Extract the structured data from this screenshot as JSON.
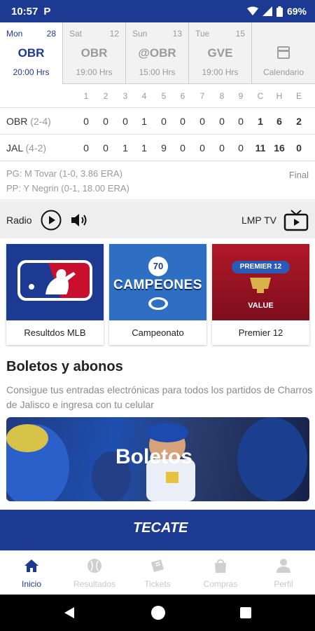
{
  "status_bar": {
    "time": "10:57",
    "app_icon": "P",
    "battery": "69%"
  },
  "games": [
    {
      "day": "Mon",
      "date": "28",
      "team": "OBR",
      "time": "20:00 Hrs",
      "active": true
    },
    {
      "day": "Sat",
      "date": "12",
      "team": "OBR",
      "time": "19:00 Hrs",
      "active": false
    },
    {
      "day": "Sun",
      "date": "13",
      "team": "@OBR",
      "time": "15:00 Hrs",
      "active": false
    },
    {
      "day": "Tue",
      "date": "15",
      "team": "GVE",
      "time": "19:00 Hrs",
      "active": false
    }
  ],
  "calendar_label": "Calendario",
  "linescore": {
    "headers": [
      "1",
      "2",
      "3",
      "4",
      "5",
      "6",
      "7",
      "8",
      "9",
      "C",
      "H",
      "E"
    ],
    "teams": [
      {
        "abbr": "OBR",
        "record": "(2-4)",
        "innings": [
          "0",
          "0",
          "0",
          "1",
          "0",
          "0",
          "0",
          "0",
          "0"
        ],
        "totals": [
          "1",
          "6",
          "2"
        ]
      },
      {
        "abbr": "JAL",
        "record": "(4-2)",
        "innings": [
          "0",
          "0",
          "1",
          "1",
          "9",
          "0",
          "0",
          "0",
          "0"
        ],
        "totals": [
          "11",
          "16",
          "0"
        ]
      }
    ]
  },
  "pitchers": {
    "winning": "PG: M Tovar (1-0, 3.86 ERA)",
    "losing": "PP: Y Negrin (0-1, 18.00 ERA)",
    "status": "Final"
  },
  "radio": {
    "radio_label": "Radio",
    "tv_label": "LMP TV"
  },
  "promos": [
    {
      "label": "Resultdos MLB"
    },
    {
      "label": "Campeonato",
      "badge_number": "70",
      "badge_text": "CAMPEONES"
    },
    {
      "label": "Premier 12",
      "badge_text": "PREMIER 12",
      "sub_text": "VALUE"
    }
  ],
  "boletos": {
    "title": "Boletos y abonos",
    "description": "Consigue tus entradas electrónicas para todos los partidos de Charros de Jalisco e ingresa con tu celular",
    "banner_text": "Boletos"
  },
  "sponsor": {
    "name": "TECATE"
  },
  "bottom_nav": [
    {
      "label": "Inicio",
      "icon": "home-icon",
      "active": true
    },
    {
      "label": "Resultados",
      "icon": "baseball-icon",
      "active": false
    },
    {
      "label": "Tickets",
      "icon": "ticket-icon",
      "active": false
    },
    {
      "label": "Compras",
      "icon": "shopping-bag-icon",
      "active": false
    },
    {
      "label": "Perfil",
      "icon": "person-icon",
      "active": false
    }
  ],
  "colors": {
    "primary": "#1d3a93",
    "mlb_red": "#c8102e",
    "premier_red": "#a3121f"
  }
}
